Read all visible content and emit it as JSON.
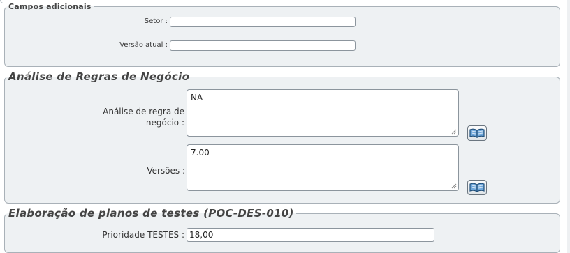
{
  "campos_adicionais": {
    "legend": "Campos adicionais",
    "setor_label": "Setor :",
    "setor_value": "",
    "versao_label": "Versão atual :",
    "versao_value": ""
  },
  "analise_regras": {
    "legend": "Análise de Regras de Negócio",
    "analise_label_line1": "Análise de regra de",
    "analise_label_line2": "negócio :",
    "analise_value": "NA",
    "versoes_label": "Versões :",
    "versoes_value": "7.00",
    "book_icon": "book-icon"
  },
  "elaboracao_planos": {
    "legend": "Elaboração de planos de testes (POC-DES-010)",
    "prioridade_label": "Prioridade TESTES :",
    "prioridade_value": "18,00"
  }
}
